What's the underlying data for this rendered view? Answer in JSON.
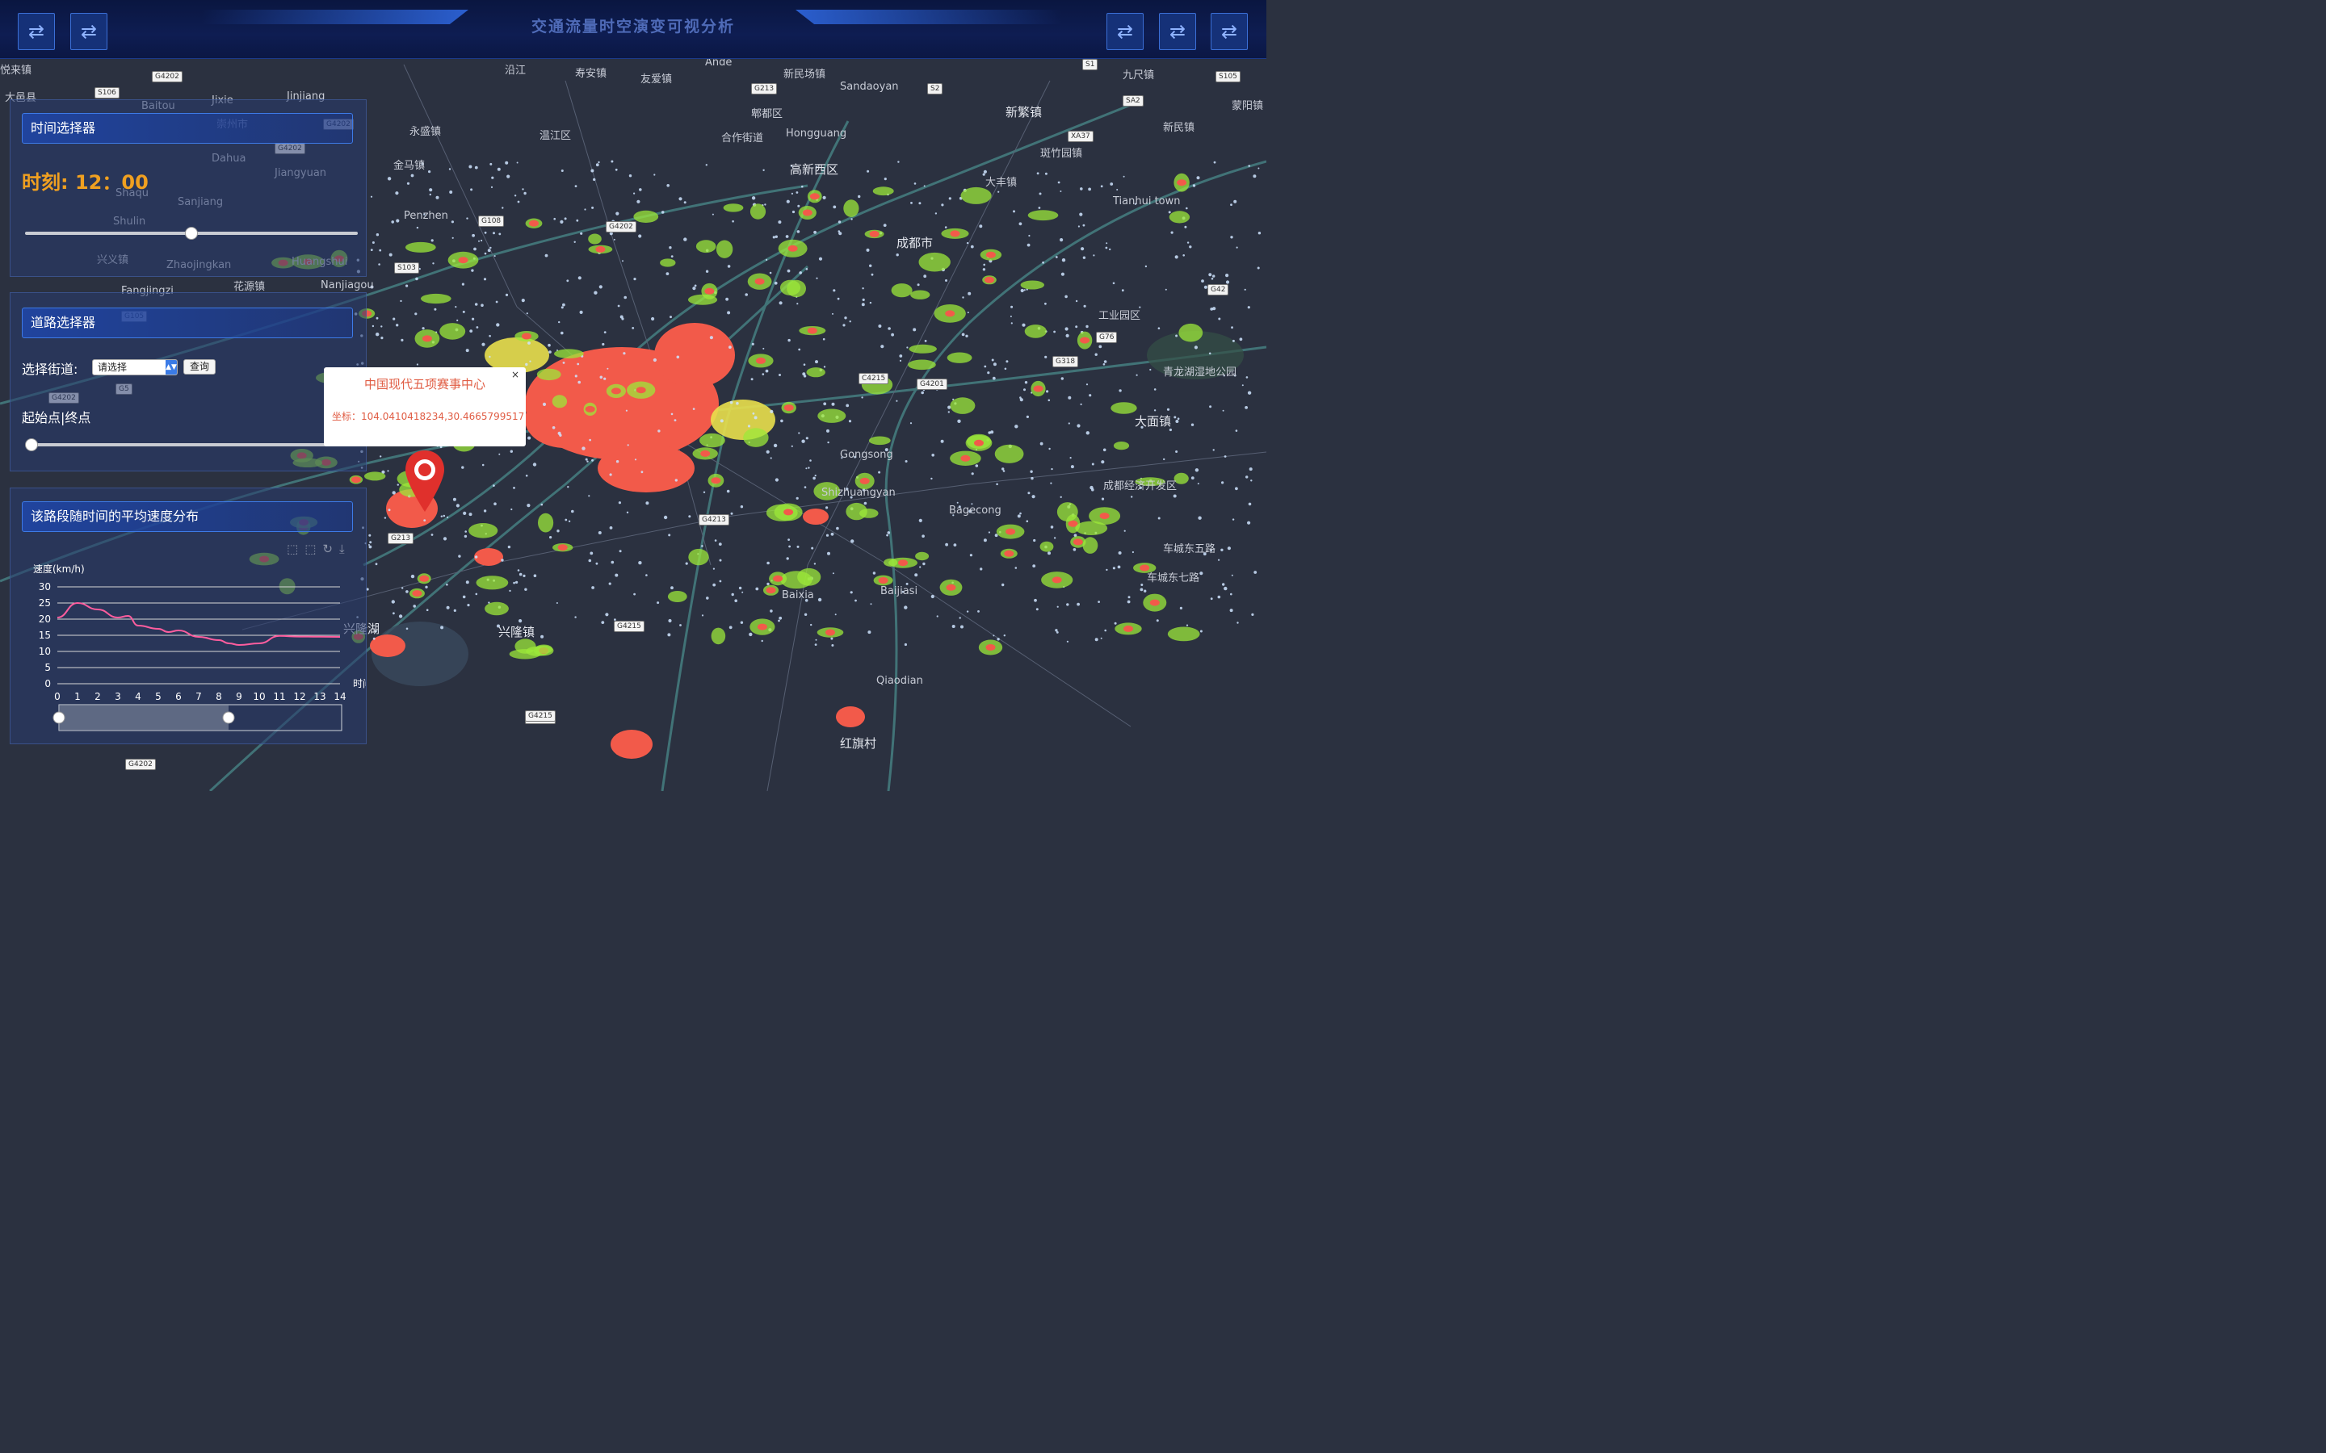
{
  "header": {
    "title": "交通流量时空演变可视分析",
    "left_buttons": [
      "swap-icon",
      "swap-icon"
    ],
    "right_buttons": [
      "swap-icon",
      "swap-icon",
      "swap-icon"
    ]
  },
  "map": {
    "labels": [
      "悦来镇",
      "大邑县",
      "崇州市",
      "Baitou",
      "Jixie",
      "Jinjiang",
      "沿江",
      "寿安镇",
      "友爱镇",
      "Ande",
      "新民场镇",
      "Sandaoyan",
      "九尺镇",
      "蒙阳镇",
      "郫都区",
      "永盛镇",
      "温江区",
      "合作街道",
      "Hongguang",
      "新繁镇",
      "新民镇",
      "金马镇",
      "高新西区",
      "斑竹园镇",
      "大丰镇",
      "Tianhui town",
      "Penzhen",
      "Dahua",
      "Jiangyuan",
      "Shaqu",
      "Sanjiang",
      "Shulin",
      "兴义镇",
      "Zhaojingkan",
      "Huangshui",
      "花源镇",
      "Fangjingzi",
      "Nanjiagou",
      "成都市",
      "工业园区",
      "青龙湖湿地公园",
      "大面镇",
      "Gongsong",
      "Shizhuangyan",
      "成都经济开发区",
      "Bagecong",
      "Baijiasi",
      "车城东五路",
      "车城东七路",
      "Baixia",
      "兴隆湖",
      "兴隆镇",
      "红旗村",
      "Qiaodian"
    ],
    "shields": [
      "S106",
      "G4202",
      "S105",
      "G4202",
      "G213",
      "G4202",
      "G108",
      "G4202",
      "S103",
      "G105",
      "G5",
      "G4202",
      "G4215",
      "C4215",
      "G4201",
      "G42",
      "G76",
      "G318",
      "G4213",
      "G4215",
      "G4215",
      "G213",
      "G4202",
      "S2",
      "XA37",
      "S1",
      "SA2"
    ],
    "heat_intensity": "high"
  },
  "time_panel": {
    "title": "时间选择器",
    "time_label": "时刻:",
    "time_value": "12：00",
    "slider_value": 0.5
  },
  "road_panel": {
    "title": "道路选择器",
    "street_label": "选择街道:",
    "select_value": "请选择",
    "query_button": "查询",
    "range_label": "起始点|终点",
    "slider_value": 0
  },
  "speed_panel": {
    "title": "该路段随时间的平均速度分布",
    "toolbox": [
      "zoom-icon",
      "zoom-reset-icon",
      "restore-icon",
      "download-icon"
    ]
  },
  "popup": {
    "title": "中国现代五项赛事中心",
    "coords": "坐标：104.0410418234,30.4665799517",
    "close": "×"
  },
  "chart_data": {
    "type": "line",
    "ylabel": "速度(km/h)",
    "xlabel": "时间",
    "x": [
      0,
      1,
      2,
      3,
      4,
      5,
      6,
      7,
      8,
      9,
      10,
      11,
      12,
      13,
      14
    ],
    "ylim": [
      0,
      30
    ],
    "yticks": [
      0,
      5,
      10,
      15,
      20,
      25,
      30
    ],
    "series": [
      {
        "values": [
          20.5,
          25,
          23,
          20.5,
          21,
          18,
          17,
          16,
          16.5,
          14.5,
          13.5,
          12.5,
          12,
          12.5,
          14.8,
          14.6,
          14.5
        ],
        "x_points": [
          0,
          1,
          2,
          3,
          3.5,
          4,
          5,
          5.5,
          6,
          7,
          8,
          8.5,
          9,
          10,
          11,
          12,
          14
        ]
      }
    ],
    "color": "#ff5d9e",
    "grid": true,
    "datazoom_range": [
      0,
      0.6
    ]
  }
}
